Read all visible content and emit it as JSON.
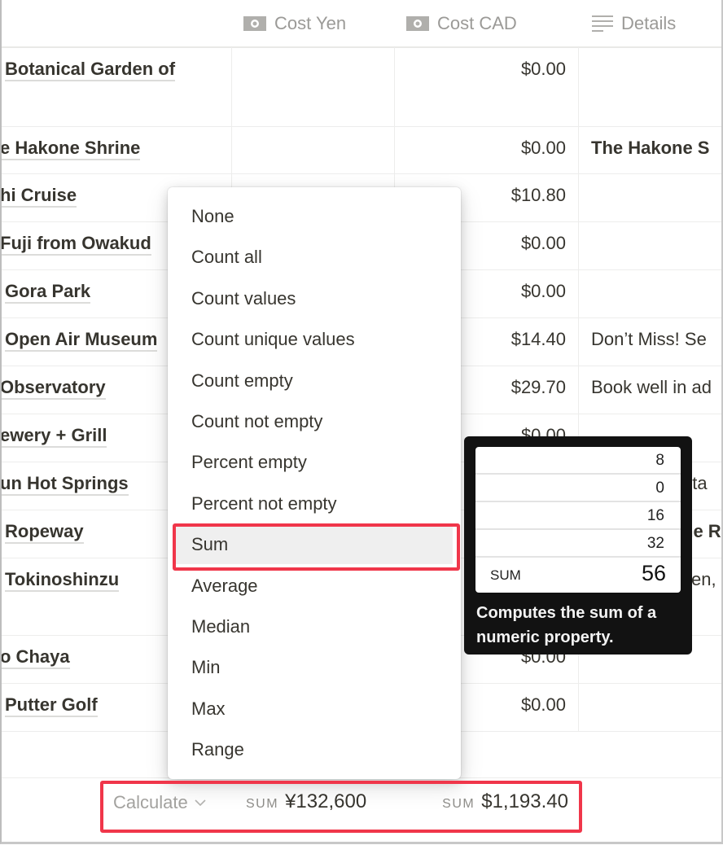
{
  "columns": {
    "cost_yen": {
      "label": "Cost Yen",
      "icon": "currency-icon"
    },
    "cost_cad": {
      "label": "Cost CAD",
      "icon": "currency-icon"
    },
    "details": {
      "label": "Details",
      "icon": "text-lines-icon"
    }
  },
  "rows": [
    {
      "name": "Botanical Garden of",
      "cost_cad": "$0.00",
      "details": ""
    },
    {
      "name": "e Hakone Shrine",
      "cost_cad": "$0.00",
      "details": "The Hakone S",
      "details_bold": true
    },
    {
      "name": "hi Cruise",
      "cost_cad": "$10.80",
      "details": ""
    },
    {
      "name": "Fuji from Owakud",
      "cost_cad": "$0.00",
      "details": ""
    },
    {
      "name": "Gora Park",
      "cost_cad": "$0.00",
      "details": ""
    },
    {
      "name": "Open Air Museum",
      "cost_cad": "$14.40",
      "details": "Don’t Miss! Se"
    },
    {
      "name": "Observatory",
      "cost_cad": "$29.70",
      "details": "Book well in ad"
    },
    {
      "name": "ewery + Grill",
      "cost_cad": "$0.00",
      "details": ""
    },
    {
      "name": "un Hot Springs",
      "cost_cad": "",
      "details": "f ta"
    },
    {
      "name": "Ropeway",
      "cost_cad": "",
      "details": "he R",
      "details_bold": true
    },
    {
      "name": "Tokinoshinzu",
      "cost_cad": "",
      "details": "sen,"
    },
    {
      "name": "o Chaya",
      "cost_cad": "$0.00",
      "details": ""
    },
    {
      "name": "Putter Golf",
      "cost_cad": "$0.00",
      "details": ""
    }
  ],
  "menu": {
    "items": [
      "None",
      "Count all",
      "Count values",
      "Count unique values",
      "Count empty",
      "Count not empty",
      "Percent empty",
      "Percent not empty",
      "Sum",
      "Average",
      "Median",
      "Min",
      "Max",
      "Range"
    ],
    "selected": "Sum"
  },
  "tooltip": {
    "values": [
      "8",
      "0",
      "16",
      "32"
    ],
    "sum_label": "SUM",
    "sum_value": "56",
    "description": "Computes the sum of a numeric property."
  },
  "footer": {
    "calculate_label": "Calculate",
    "yen_sum_label": "SUM",
    "yen_sum_value": "¥132,600",
    "cad_sum_label": "SUM",
    "cad_sum_value": "$1,193.40"
  },
  "colors": {
    "highlight": "#f0364a",
    "tooltip_bg": "#121212"
  }
}
